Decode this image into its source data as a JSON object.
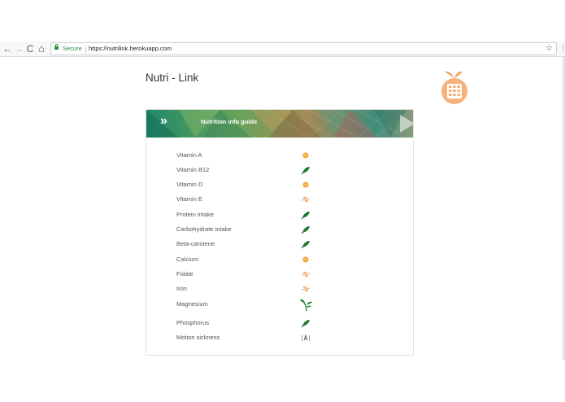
{
  "browser": {
    "back_icon": "←",
    "forward_icon": "→",
    "reload_icon": "C",
    "home_icon": "⌂",
    "secure_label": "Secure",
    "url": "https://nutrilink.herokuapp.com",
    "star_icon": "☆",
    "menu_icon": "⋮"
  },
  "page": {
    "title": "Nutri - Link",
    "logo_icon": "orange-calculator-icon"
  },
  "guide": {
    "arrows": "»",
    "title": "Nutrition info guide",
    "items": [
      {
        "label": "Vitamin A",
        "icon": "orange-dot-icon"
      },
      {
        "label": "Vitamin B12",
        "icon": "green-leaf-icon"
      },
      {
        "label": "Vitamin D",
        "icon": "orange-dot-icon"
      },
      {
        "label": "Vitamin E",
        "icon": "orange-sprig-icon"
      },
      {
        "label": "Protein intake",
        "icon": "green-leaf-icon"
      },
      {
        "label": "Carbohydrate intake",
        "icon": "green-leaf-icon"
      },
      {
        "label": "Beta-carotene",
        "icon": "green-leaf-icon"
      },
      {
        "label": "Calcium",
        "icon": "orange-dot-icon"
      },
      {
        "label": "Folate",
        "icon": "orange-sprig-icon"
      },
      {
        "label": "Iron",
        "icon": "orange-sprig-icon"
      },
      {
        "label": "Magnesium",
        "icon": "green-plant-icon"
      },
      {
        "label": "Phosphorus",
        "icon": "green-leaf-icon"
      },
      {
        "label": "Motion sickness",
        "icon": "ginger-icon"
      }
    ]
  },
  "colors": {
    "accent_orange": "#f6b27a",
    "leaf_green": "#1f7a2e",
    "dot_orange": "#f0a842"
  }
}
